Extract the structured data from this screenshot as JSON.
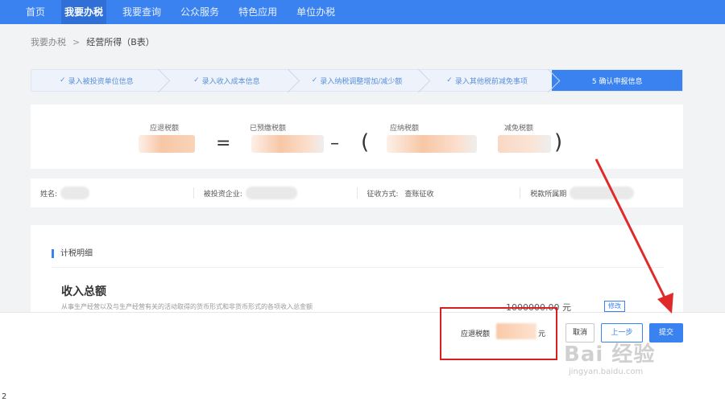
{
  "nav": {
    "items": [
      "首页",
      "我要办税",
      "我要查询",
      "公众服务",
      "特色应用",
      "单位办税"
    ],
    "active_index": 1
  },
  "breadcrumb": {
    "root": "我要办税",
    "separator": ">",
    "current": "经营所得（B表）"
  },
  "steps": [
    {
      "label": "录入被投资单位信息",
      "done": true
    },
    {
      "label": "录入收入成本信息",
      "done": true
    },
    {
      "label": "录入纳税调整增加/减少额",
      "done": true
    },
    {
      "label": "录入其他税前减免事项",
      "done": true
    },
    {
      "label": "5 确认申报信息",
      "done": false,
      "active": true
    }
  ],
  "formula": {
    "tax_payable_label": "应退税额",
    "prepaid_label": "已预缴税额",
    "payable_label": "应纳税额",
    "reduction_label": "减免税额",
    "equals": "=",
    "minus": "–",
    "open_paren": "(",
    "close_paren": ")"
  },
  "info": {
    "name_label": "姓名:",
    "enterprise_label": "被投资企业:",
    "collection_label": "征收方式:",
    "collection_value": "查账征收",
    "period_label": "税款所属期"
  },
  "detail": {
    "section_title": "计税明细",
    "income_title": "收入总额",
    "income_desc": "从事生产经营以及与生产经营有关的活动取得的货币形式和非货币形式的各项收入总金额",
    "income_amount": "1000000.00",
    "income_unit": "元",
    "edit_button": "修改"
  },
  "bottom": {
    "tax_label": "应退税额",
    "tax_unit": "元",
    "cancel_label": "取消",
    "prev_label": "上一步",
    "submit_label": "提交"
  },
  "watermark": {
    "brand": "Bai 经验",
    "url": "jingyan.baidu.com"
  },
  "corner_number": "2",
  "colors": {
    "primary": "#3a82f0",
    "highlight_box": "#d42020",
    "blur_orange": "#f9c9a8"
  }
}
